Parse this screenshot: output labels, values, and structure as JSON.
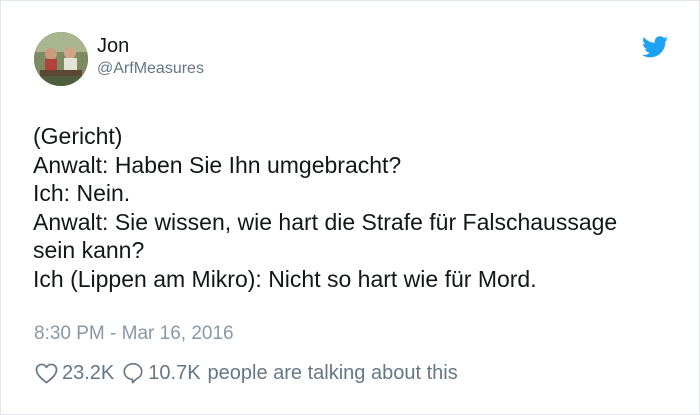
{
  "user": {
    "display_name": "Jon",
    "handle": "@ArfMeasures"
  },
  "tweet": {
    "lines": [
      "(Gericht)",
      "Anwalt: Haben Sie Ihn umgebracht?",
      "Ich: Nein.",
      "Anwalt: Sie wissen, wie hart die Strafe für Falschaussage",
      "sein kann?",
      "Ich (Lippen am Mikro): Nicht so hart wie für Mord."
    ],
    "timestamp": "8:30 PM - Mar 16, 2016"
  },
  "engagement": {
    "likes": "23.2K",
    "replies": "10.7K",
    "talking_text": "people are talking about this"
  },
  "colors": {
    "twitter_blue": "#1da1f2",
    "secondary_text": "#657786",
    "timestamp_text": "#8899a6",
    "border": "#e1e8ed"
  },
  "icons": {
    "brand": "twitter-bird-icon",
    "like": "heart-icon",
    "reply": "speech-bubble-icon"
  }
}
